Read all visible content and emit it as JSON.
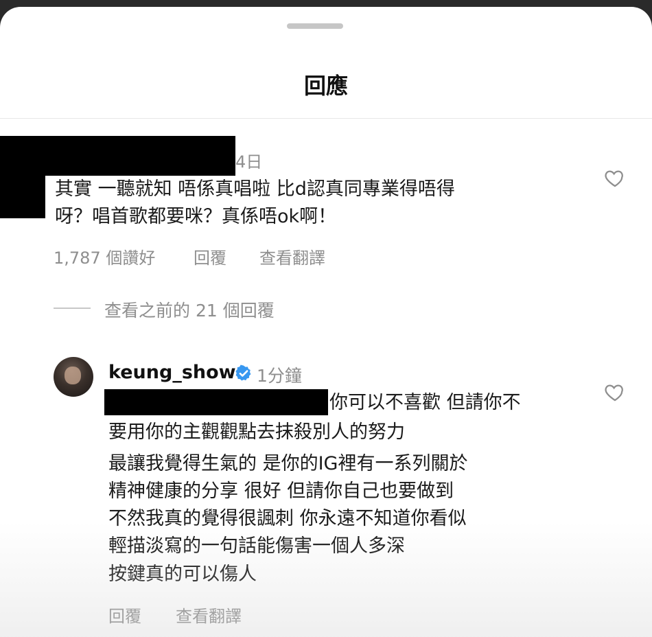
{
  "sheet": {
    "title": "回應"
  },
  "comment": {
    "time": "4日",
    "lines": [
      "其實 一聽就知 唔係真唱啦 比d認真同專業得唔得",
      "呀？唱首歌都要咪？真係唔ok啊！"
    ],
    "likes": "1,787 個讚好",
    "reply_label": "回覆",
    "translate_label": "查看翻譯"
  },
  "view_previous": "查看之前的 21 個回覆",
  "reply": {
    "username": "keung_show",
    "time": "1分鐘",
    "line1": "你可以不喜歡 但請你不",
    "paragraphs": [
      "要用你的主觀觀點去抹殺別人的努力",
      "最讓我覺得生氣的 是你的IG裡有一系列關於\n精神健康的分享 很好 但請你自己也要做到\n不然我真的覺得很諷刺 你永遠不知道你看似\n輕描淡寫的一句話能傷害一個人多深",
      "按鍵真的可以傷人"
    ],
    "reply_label": "回覆",
    "translate_label": "查看翻譯"
  }
}
